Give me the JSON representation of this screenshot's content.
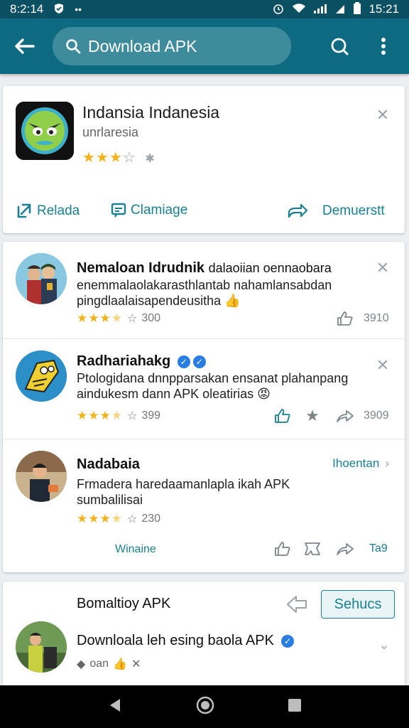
{
  "status_bar": {
    "time_left": "8:2:14",
    "time_right": "15:21"
  },
  "search": {
    "value": "Download APK"
  },
  "app_card": {
    "title": "Indansia Indanesia",
    "subtitle": "unrlaresia",
    "rating_filled": 3,
    "rating_total": 4,
    "actions": {
      "left": "Relada",
      "middle": "Clamiage",
      "right": "Demuerstt"
    }
  },
  "feed": {
    "posts": [
      {
        "name": "Nemaloan Idrudnik",
        "name_tail": "dalaoiian oennaobara",
        "body": "enemmalaolakarasthlantab nahamlansabdan pingdlaalaisapendeusitha",
        "emoji": "👍",
        "rating_filled": 3,
        "rating_half": true,
        "meta_count": "300",
        "likes": "3910"
      },
      {
        "name": "Radhariahakg",
        "body": "Ptologidana dnnpparsakan ensanat plahanpang aindukesm dann APK oleatirias",
        "emoji": "😡",
        "rating_filled": 3,
        "rating_half": true,
        "meta_count": "399",
        "shares": "3909"
      },
      {
        "name": "Nadabaia",
        "link_label": "Ihoentan",
        "body": "Frmadera haredaamanlapla ikah APK sumbalilisai",
        "rating_filled": 3,
        "rating_half": true,
        "meta_count": "230",
        "footer_label": "Winaine",
        "count_right": "Ta9"
      }
    ]
  },
  "bottom_card": {
    "heading": "Bomaltioy APK",
    "button_label": "Sehucs",
    "post_text": "Downloala leh esing baola APK",
    "meta_text": "oan"
  },
  "colors": {
    "app_bar": "#0e6a80",
    "accent": "#1a8091",
    "star": "#f2b21b",
    "verified": "#2a7de1"
  }
}
